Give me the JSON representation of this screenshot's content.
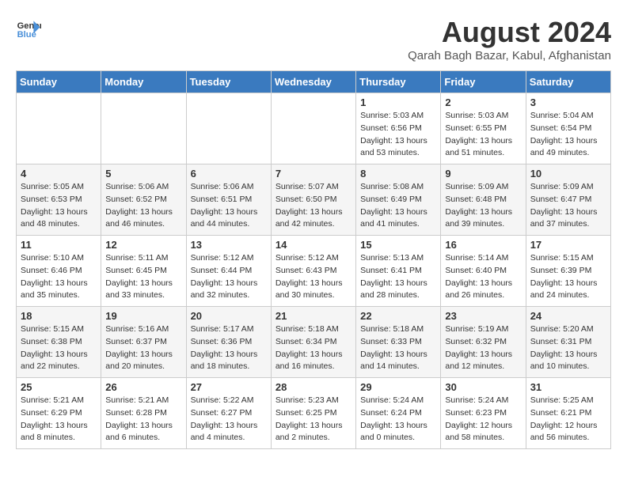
{
  "header": {
    "logo_line1": "General",
    "logo_line2": "Blue",
    "month_title": "August 2024",
    "location": "Qarah Bagh Bazar, Kabul, Afghanistan"
  },
  "weekdays": [
    "Sunday",
    "Monday",
    "Tuesday",
    "Wednesday",
    "Thursday",
    "Friday",
    "Saturday"
  ],
  "weeks": [
    [
      {
        "day": "",
        "info": ""
      },
      {
        "day": "",
        "info": ""
      },
      {
        "day": "",
        "info": ""
      },
      {
        "day": "",
        "info": ""
      },
      {
        "day": "1",
        "info": "Sunrise: 5:03 AM\nSunset: 6:56 PM\nDaylight: 13 hours\nand 53 minutes."
      },
      {
        "day": "2",
        "info": "Sunrise: 5:03 AM\nSunset: 6:55 PM\nDaylight: 13 hours\nand 51 minutes."
      },
      {
        "day": "3",
        "info": "Sunrise: 5:04 AM\nSunset: 6:54 PM\nDaylight: 13 hours\nand 49 minutes."
      }
    ],
    [
      {
        "day": "4",
        "info": "Sunrise: 5:05 AM\nSunset: 6:53 PM\nDaylight: 13 hours\nand 48 minutes."
      },
      {
        "day": "5",
        "info": "Sunrise: 5:06 AM\nSunset: 6:52 PM\nDaylight: 13 hours\nand 46 minutes."
      },
      {
        "day": "6",
        "info": "Sunrise: 5:06 AM\nSunset: 6:51 PM\nDaylight: 13 hours\nand 44 minutes."
      },
      {
        "day": "7",
        "info": "Sunrise: 5:07 AM\nSunset: 6:50 PM\nDaylight: 13 hours\nand 42 minutes."
      },
      {
        "day": "8",
        "info": "Sunrise: 5:08 AM\nSunset: 6:49 PM\nDaylight: 13 hours\nand 41 minutes."
      },
      {
        "day": "9",
        "info": "Sunrise: 5:09 AM\nSunset: 6:48 PM\nDaylight: 13 hours\nand 39 minutes."
      },
      {
        "day": "10",
        "info": "Sunrise: 5:09 AM\nSunset: 6:47 PM\nDaylight: 13 hours\nand 37 minutes."
      }
    ],
    [
      {
        "day": "11",
        "info": "Sunrise: 5:10 AM\nSunset: 6:46 PM\nDaylight: 13 hours\nand 35 minutes."
      },
      {
        "day": "12",
        "info": "Sunrise: 5:11 AM\nSunset: 6:45 PM\nDaylight: 13 hours\nand 33 minutes."
      },
      {
        "day": "13",
        "info": "Sunrise: 5:12 AM\nSunset: 6:44 PM\nDaylight: 13 hours\nand 32 minutes."
      },
      {
        "day": "14",
        "info": "Sunrise: 5:12 AM\nSunset: 6:43 PM\nDaylight: 13 hours\nand 30 minutes."
      },
      {
        "day": "15",
        "info": "Sunrise: 5:13 AM\nSunset: 6:41 PM\nDaylight: 13 hours\nand 28 minutes."
      },
      {
        "day": "16",
        "info": "Sunrise: 5:14 AM\nSunset: 6:40 PM\nDaylight: 13 hours\nand 26 minutes."
      },
      {
        "day": "17",
        "info": "Sunrise: 5:15 AM\nSunset: 6:39 PM\nDaylight: 13 hours\nand 24 minutes."
      }
    ],
    [
      {
        "day": "18",
        "info": "Sunrise: 5:15 AM\nSunset: 6:38 PM\nDaylight: 13 hours\nand 22 minutes."
      },
      {
        "day": "19",
        "info": "Sunrise: 5:16 AM\nSunset: 6:37 PM\nDaylight: 13 hours\nand 20 minutes."
      },
      {
        "day": "20",
        "info": "Sunrise: 5:17 AM\nSunset: 6:36 PM\nDaylight: 13 hours\nand 18 minutes."
      },
      {
        "day": "21",
        "info": "Sunrise: 5:18 AM\nSunset: 6:34 PM\nDaylight: 13 hours\nand 16 minutes."
      },
      {
        "day": "22",
        "info": "Sunrise: 5:18 AM\nSunset: 6:33 PM\nDaylight: 13 hours\nand 14 minutes."
      },
      {
        "day": "23",
        "info": "Sunrise: 5:19 AM\nSunset: 6:32 PM\nDaylight: 13 hours\nand 12 minutes."
      },
      {
        "day": "24",
        "info": "Sunrise: 5:20 AM\nSunset: 6:31 PM\nDaylight: 13 hours\nand 10 minutes."
      }
    ],
    [
      {
        "day": "25",
        "info": "Sunrise: 5:21 AM\nSunset: 6:29 PM\nDaylight: 13 hours\nand 8 minutes."
      },
      {
        "day": "26",
        "info": "Sunrise: 5:21 AM\nSunset: 6:28 PM\nDaylight: 13 hours\nand 6 minutes."
      },
      {
        "day": "27",
        "info": "Sunrise: 5:22 AM\nSunset: 6:27 PM\nDaylight: 13 hours\nand 4 minutes."
      },
      {
        "day": "28",
        "info": "Sunrise: 5:23 AM\nSunset: 6:25 PM\nDaylight: 13 hours\nand 2 minutes."
      },
      {
        "day": "29",
        "info": "Sunrise: 5:24 AM\nSunset: 6:24 PM\nDaylight: 13 hours\nand 0 minutes."
      },
      {
        "day": "30",
        "info": "Sunrise: 5:24 AM\nSunset: 6:23 PM\nDaylight: 12 hours\nand 58 minutes."
      },
      {
        "day": "31",
        "info": "Sunrise: 5:25 AM\nSunset: 6:21 PM\nDaylight: 12 hours\nand 56 minutes."
      }
    ]
  ]
}
